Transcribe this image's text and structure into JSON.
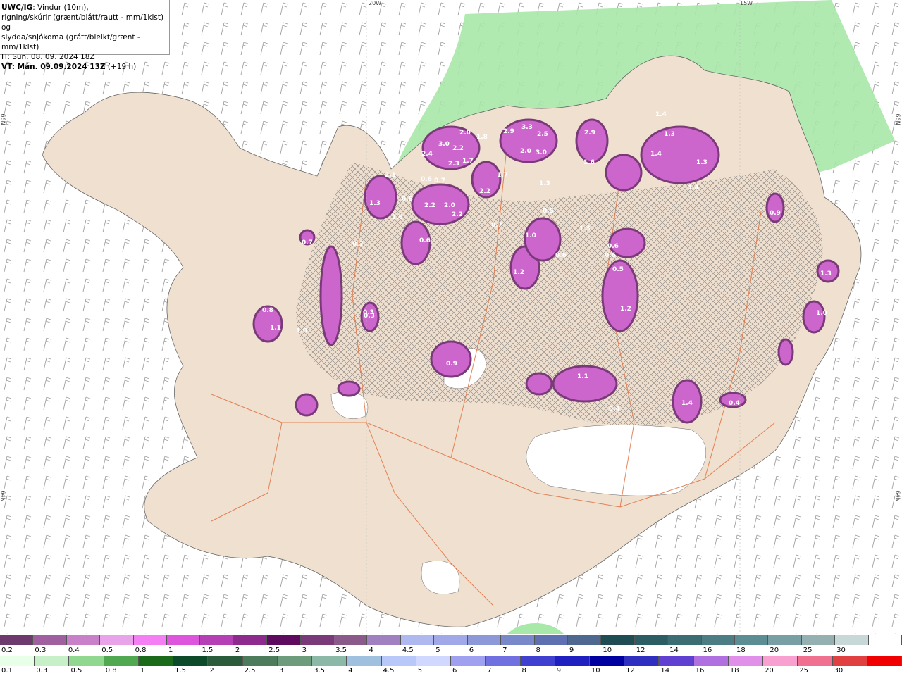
{
  "header": {
    "source": "UWC/IG",
    "line1": ": Vindur (10m),",
    "line2": "rigning/skúrir (grænt/blátt/rautt - mm/1klst) og",
    "line3": "slydda/snjókoma (grátt/bleikt/grænt - mm/1klst)",
    "it": "IT: Sun. 08. 09. 2024 18Z",
    "vt_label": "VT: Mán. 09.09.2024 13Z",
    "vt_offset": " (+19 h)"
  },
  "map_labels": {
    "lon_20w": "20W",
    "lon_15w": "15W",
    "lat_66n_left": "66N",
    "lat_66n_right": "66N",
    "lat_64n_left": "64N",
    "lat_64n_right": "64N"
  },
  "colors": {
    "land": "#f0e0d0",
    "sea": "#ffffff",
    "rain_green": "#a8e8a8",
    "snow_purple": "#cc66cc",
    "road": "#e07040"
  },
  "legend_snow": {
    "colors": [
      "#6e3a6e",
      "#a060a0",
      "#c880c8",
      "#e9a3e9",
      "#f47ef4",
      "#dd55dd",
      "#b540b5",
      "#8e2a8e",
      "#5e0a5e",
      "#7a3a7a",
      "#8a5a8a",
      "#a080c0",
      "#b0b8f0",
      "#a0a8e8",
      "#8c98d8",
      "#7888c8",
      "#5e70b0",
      "#4e6890",
      "#204c54",
      "#2c5c64",
      "#3c6c74",
      "#4c7c84",
      "#5c8c94",
      "#78a0a4",
      "#94b0b0",
      "#c8d8d8",
      "#ffffff"
    ],
    "labels": [
      "0.2",
      "0.3",
      "0.4",
      "0.5",
      "0.8",
      "1",
      "1.5",
      "2",
      "2.5",
      "3",
      "3.5",
      "4",
      "4.5",
      "5",
      "6",
      "7",
      "8",
      "9",
      "10",
      "12",
      "14",
      "16",
      "18",
      "20",
      "25",
      "30"
    ]
  },
  "legend_rain": {
    "colors": [
      "#e8ffe8",
      "#c8f0c8",
      "#90d890",
      "#50a850",
      "#1a6a1a",
      "#0c4a2a",
      "#2a5c3c",
      "#4c7c5c",
      "#6c9c7c",
      "#8cb8a8",
      "#a0c0e0",
      "#b8c8f8",
      "#d0d8ff",
      "#a0a0f0",
      "#7070e0",
      "#4040d0",
      "#2020c0",
      "#0000a0",
      "#3030c0",
      "#6040d0",
      "#b070e0",
      "#e090e8",
      "#f8a0d0",
      "#f07090",
      "#e04040",
      "#f00000"
    ],
    "labels": [
      "0.1",
      "0.3",
      "0.5",
      "0.8",
      "1",
      "1.5",
      "2",
      "2.5",
      "3",
      "3.5",
      "4",
      "4.5",
      "5",
      "6",
      "7",
      "8",
      "9",
      "10",
      "12",
      "14",
      "16",
      "18",
      "20",
      "25",
      "30"
    ]
  },
  "precip_values": [
    {
      "v": "3.0"
    },
    {
      "v": "2.2"
    },
    {
      "v": "2.4"
    },
    {
      "v": "2.3"
    },
    {
      "v": "1.7"
    },
    {
      "v": "2.0"
    },
    {
      "v": "1.8"
    },
    {
      "v": "2.9"
    },
    {
      "v": "3.3"
    },
    {
      "v": "2.5"
    },
    {
      "v": "3.0"
    },
    {
      "v": "2.0"
    },
    {
      "v": "2.9"
    },
    {
      "v": "1.6"
    },
    {
      "v": "1.4"
    },
    {
      "v": "1.3"
    },
    {
      "v": "1.4"
    },
    {
      "v": "1.3"
    },
    {
      "v": "1.4"
    },
    {
      "v": "2.1"
    },
    {
      "v": "1.3"
    },
    {
      "v": "1.6"
    },
    {
      "v": "2.2"
    },
    {
      "v": "2.0"
    },
    {
      "v": "2.2"
    },
    {
      "v": "0.7"
    },
    {
      "v": "0.8"
    },
    {
      "v": "2.2"
    },
    {
      "v": "1.7"
    },
    {
      "v": "1.3"
    },
    {
      "v": "0.5"
    },
    {
      "v": "1.3"
    },
    {
      "v": "0.7"
    },
    {
      "v": "1.0"
    },
    {
      "v": "0.6"
    },
    {
      "v": "0.6"
    },
    {
      "v": "0.5"
    },
    {
      "v": "1.2"
    },
    {
      "v": "1.2"
    },
    {
      "v": "0.9"
    },
    {
      "v": "1.3"
    },
    {
      "v": "1.0"
    },
    {
      "v": "0.8"
    },
    {
      "v": "1.1"
    },
    {
      "v": "1.0"
    },
    {
      "v": "0.3"
    },
    {
      "v": "0.9"
    },
    {
      "v": "1.1"
    },
    {
      "v": "0.4"
    },
    {
      "v": "1.4"
    },
    {
      "v": "0.4"
    },
    {
      "v": "0.3"
    },
    {
      "v": "0.7"
    },
    {
      "v": "0.7"
    },
    {
      "v": "0.6"
    },
    {
      "v": "0.6"
    },
    {
      "v": "0.6"
    }
  ]
}
